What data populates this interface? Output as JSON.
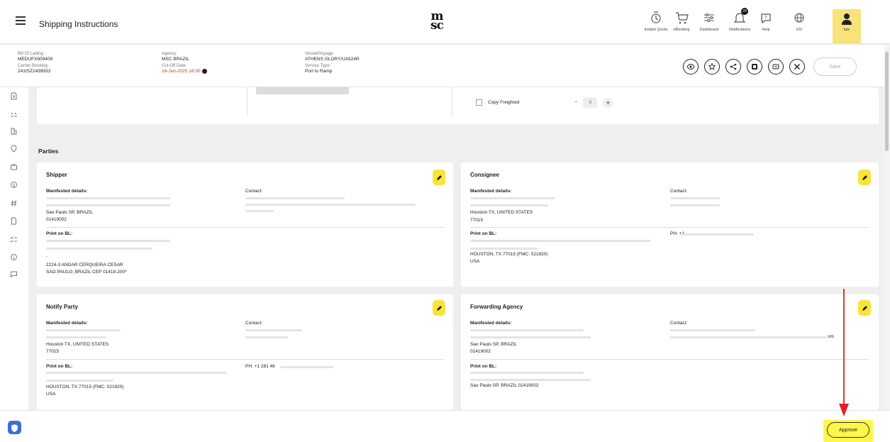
{
  "header": {
    "title": "Shipping Instructions",
    "logo": "msc",
    "nav": [
      {
        "label": "Instant Quote",
        "icon": "instant-quote-icon"
      },
      {
        "label": "eBooking",
        "icon": "cart-icon"
      },
      {
        "label": "Dashboard",
        "icon": "dashboard-icon"
      },
      {
        "label": "Notifications",
        "icon": "bell-icon",
        "badge": "29"
      },
      {
        "label": "Help",
        "icon": "help-icon"
      },
      {
        "label": "EN",
        "icon": "globe-icon"
      }
    ],
    "user_label": "luis"
  },
  "info": {
    "bl_label": "Bill Of Lading:",
    "bl_value": "MEDUFX609409",
    "carrier_label": "Carrier Booking:",
    "carrier_value": "241ISZ2439933",
    "agency_label": "Agency:",
    "agency_value": "MSC BRAZIL",
    "cutoff_label": "Cut-Off Date:",
    "cutoff_value": "16-Jun-2025 18:00",
    "vessel_label": "Vessel/Voyage:",
    "vessel_value": "ATHENS GLORY/UA524R",
    "service_label": "Service Type:",
    "service_value": "Port to Ramp"
  },
  "actions": {
    "save_label": "Save"
  },
  "freight": {
    "copy_label": "Copy Freighted",
    "minus": "−",
    "qty": "0",
    "plus": "+"
  },
  "parties": {
    "title": "Parties",
    "manifested_label": "Manifested details:",
    "contact_label": "Contact:",
    "print_label": "Print on BL:",
    "shipper": {
      "title": "Shipper",
      "m_lines": [
        "Sao Paulo SP, BRAZIL",
        "01419002"
      ],
      "p_lines": [
        ",",
        "2224-3 ANDAR CERQUEIRA CESAR",
        "SAO PAULO, BRAZIL CEP 01418-200*"
      ]
    },
    "consignee": {
      "title": "Consignee",
      "m_lines": [
        "Houston TX, UNITED STATES",
        "77015"
      ],
      "p_lines": [
        "HOUSTON, TX 77015 (FMC: 021920)",
        "USA"
      ],
      "phone": "PH: +1"
    },
    "notify": {
      "title": "Notify Party",
      "m_lines": [
        "Houston TX, UNITED STATES",
        "77015"
      ],
      "p_lines": [
        "HOUSTON, TX 77015 (FMC: 021920)",
        "USA"
      ],
      "phone": "PH: +1 281 46"
    },
    "forwarding": {
      "title": "Forwarding Agency",
      "m_lines": [
        "Sao Paulo SP, BRAZIL",
        "01419002"
      ],
      "p_lines": [
        "Sao Paulo SP, BRAZIL 01419002"
      ],
      "contact_tail": "om"
    }
  },
  "footer": {
    "approve_label": "Approve"
  },
  "colors": {
    "highlight": "#f8e43a",
    "arrow": "#e02020",
    "due": "#c0392b"
  }
}
